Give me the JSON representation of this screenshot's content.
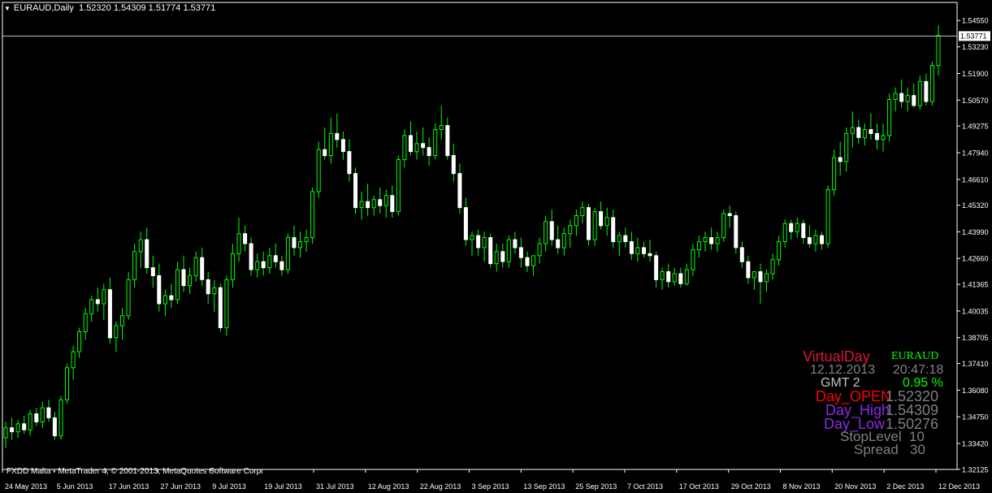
{
  "header": {
    "symbol_timeframe": "EURAUD,Daily",
    "ohlc": "1.52320 1.54309 1.51774 1.53771"
  },
  "footer": {
    "copyright": "FXDD Malta - MetaTrader 4, © 2001-2013, MetaQuotes Software Corp."
  },
  "colors": {
    "background": "#000000",
    "bull": "#00ff00",
    "bear": "#ffffff",
    "axis": "#ffffff",
    "current_price_line": "#c0c0c0"
  },
  "overlay": {
    "title": "VirtualDay",
    "symbol": "EURAUD",
    "date": "12.12.2013",
    "time": "20:47:18",
    "gmt": "GMT 2",
    "percent": "0.95 %",
    "open_label": "Day_OPEN",
    "open_value": "1.52320",
    "high_label": "Day_High",
    "high_value": "1.54309",
    "low_label": "Day_Low",
    "low_value": "1.50276",
    "stoplevel": "StopLevel  10",
    "spread": "Spread   30",
    "colors": {
      "title": "#dc143c",
      "symbol": "#00ff00",
      "date_time": "#808080",
      "gmt": "#c0c0c0",
      "percent": "#00ff00",
      "open_label": "#ff0000",
      "high_low_label": "#8a2be2",
      "values": "#808080",
      "stoplevel": "#808080"
    }
  },
  "chart_data": {
    "type": "candlestick",
    "ylim": [
      1.3212,
      1.5545
    ],
    "y_ticks": [
      "1.54550",
      "1.53230",
      "1.51900",
      "1.50570",
      "1.49275",
      "1.47940",
      "1.46610",
      "1.45320",
      "1.43990",
      "1.42660",
      "1.41365",
      "1.40035",
      "1.38705",
      "1.37410",
      "1.36080",
      "1.34750",
      "1.33420",
      "1.32125"
    ],
    "current_price": "1.53771",
    "x_labels": [
      "24 May 2013",
      "5 Jun 2013",
      "17 Jun 2013",
      "27 Jun 2013",
      "9 Jul 2013",
      "19 Jul 2013",
      "31 Jul 2013",
      "12 Aug 2013",
      "22 Aug 2013",
      "3 Sep 2013",
      "13 Sep 2013",
      "25 Sep 2013",
      "7 Oct 2013",
      "17 Oct 2013",
      "29 Oct 2013",
      "8 Nov 2013",
      "20 Nov 2013",
      "2 Dec 2013",
      "12 Dec 2013"
    ],
    "candles": [
      [
        1.337,
        1.345,
        1.332,
        1.342
      ],
      [
        1.342,
        1.347,
        1.336,
        1.34
      ],
      [
        1.34,
        1.346,
        1.337,
        1.344
      ],
      [
        1.344,
        1.348,
        1.339,
        1.341
      ],
      [
        1.341,
        1.351,
        1.338,
        1.349
      ],
      [
        1.349,
        1.352,
        1.343,
        1.345
      ],
      [
        1.345,
        1.355,
        1.342,
        1.352
      ],
      [
        1.352,
        1.356,
        1.345,
        1.347
      ],
      [
        1.347,
        1.35,
        1.336,
        1.338
      ],
      [
        1.338,
        1.358,
        1.336,
        1.356
      ],
      [
        1.356,
        1.374,
        1.354,
        1.372
      ],
      [
        1.372,
        1.383,
        1.366,
        1.38
      ],
      [
        1.38,
        1.392,
        1.377,
        1.39
      ],
      [
        1.39,
        1.402,
        1.386,
        1.399
      ],
      [
        1.399,
        1.408,
        1.395,
        1.406
      ],
      [
        1.406,
        1.412,
        1.4,
        1.404
      ],
      [
        1.404,
        1.414,
        1.396,
        1.411
      ],
      [
        1.411,
        1.417,
        1.384,
        1.387
      ],
      [
        1.387,
        1.395,
        1.38,
        1.393
      ],
      [
        1.393,
        1.402,
        1.386,
        1.398
      ],
      [
        1.398,
        1.42,
        1.396,
        1.416
      ],
      [
        1.416,
        1.434,
        1.412,
        1.43
      ],
      [
        1.43,
        1.44,
        1.422,
        1.436
      ],
      [
        1.436,
        1.442,
        1.419,
        1.422
      ],
      [
        1.422,
        1.428,
        1.412,
        1.418
      ],
      [
        1.418,
        1.424,
        1.4,
        1.404
      ],
      [
        1.404,
        1.411,
        1.398,
        1.408
      ],
      [
        1.408,
        1.414,
        1.402,
        1.406
      ],
      [
        1.406,
        1.425,
        1.404,
        1.421
      ],
      [
        1.421,
        1.428,
        1.41,
        1.413
      ],
      [
        1.413,
        1.422,
        1.409,
        1.418
      ],
      [
        1.418,
        1.43,
        1.415,
        1.427
      ],
      [
        1.427,
        1.432,
        1.413,
        1.416
      ],
      [
        1.416,
        1.42,
        1.404,
        1.409
      ],
      [
        1.409,
        1.416,
        1.4,
        1.412
      ],
      [
        1.412,
        1.414,
        1.39,
        1.392
      ],
      [
        1.392,
        1.418,
        1.388,
        1.416
      ],
      [
        1.416,
        1.434,
        1.412,
        1.429
      ],
      [
        1.429,
        1.447,
        1.425,
        1.439
      ],
      [
        1.439,
        1.443,
        1.43,
        1.434
      ],
      [
        1.434,
        1.437,
        1.418,
        1.421
      ],
      [
        1.421,
        1.429,
        1.417,
        1.425
      ],
      [
        1.425,
        1.43,
        1.418,
        1.422
      ],
      [
        1.422,
        1.432,
        1.419,
        1.428
      ],
      [
        1.428,
        1.434,
        1.422,
        1.425
      ],
      [
        1.425,
        1.428,
        1.418,
        1.421
      ],
      [
        1.421,
        1.439,
        1.419,
        1.437
      ],
      [
        1.437,
        1.443,
        1.428,
        1.432
      ],
      [
        1.432,
        1.44,
        1.427,
        1.435
      ],
      [
        1.435,
        1.441,
        1.43,
        1.437
      ],
      [
        1.437,
        1.462,
        1.434,
        1.46
      ],
      [
        1.46,
        1.485,
        1.457,
        1.481
      ],
      [
        1.481,
        1.492,
        1.476,
        1.478
      ],
      [
        1.478,
        1.497,
        1.474,
        1.489
      ],
      [
        1.489,
        1.499,
        1.482,
        1.486
      ],
      [
        1.486,
        1.49,
        1.476,
        1.48
      ],
      [
        1.48,
        1.486,
        1.465,
        1.469
      ],
      [
        1.469,
        1.472,
        1.449,
        1.452
      ],
      [
        1.452,
        1.46,
        1.446,
        1.455
      ],
      [
        1.455,
        1.464,
        1.448,
        1.452
      ],
      [
        1.452,
        1.458,
        1.448,
        1.456
      ],
      [
        1.456,
        1.462,
        1.449,
        1.453
      ],
      [
        1.453,
        1.461,
        1.447,
        1.458
      ],
      [
        1.458,
        1.463,
        1.447,
        1.45
      ],
      [
        1.45,
        1.478,
        1.448,
        1.476
      ],
      [
        1.476,
        1.491,
        1.472,
        1.488
      ],
      [
        1.488,
        1.495,
        1.478,
        1.48
      ],
      [
        1.48,
        1.49,
        1.476,
        1.484
      ],
      [
        1.484,
        1.492,
        1.478,
        1.482
      ],
      [
        1.482,
        1.487,
        1.473,
        1.478
      ],
      [
        1.478,
        1.494,
        1.476,
        1.491
      ],
      [
        1.491,
        1.503,
        1.486,
        1.493
      ],
      [
        1.493,
        1.497,
        1.476,
        1.478
      ],
      [
        1.478,
        1.484,
        1.465,
        1.469
      ],
      [
        1.469,
        1.474,
        1.449,
        1.452
      ],
      [
        1.452,
        1.457,
        1.433,
        1.436
      ],
      [
        1.436,
        1.44,
        1.428,
        1.438
      ],
      [
        1.438,
        1.441,
        1.428,
        1.432
      ],
      [
        1.432,
        1.44,
        1.425,
        1.437
      ],
      [
        1.437,
        1.439,
        1.422,
        1.424
      ],
      [
        1.424,
        1.434,
        1.42,
        1.43
      ],
      [
        1.43,
        1.434,
        1.422,
        1.425
      ],
      [
        1.425,
        1.438,
        1.422,
        1.436
      ],
      [
        1.436,
        1.44,
        1.429,
        1.432
      ],
      [
        1.432,
        1.437,
        1.422,
        1.427
      ],
      [
        1.427,
        1.43,
        1.42,
        1.423
      ],
      [
        1.423,
        1.427,
        1.418,
        1.428
      ],
      [
        1.428,
        1.437,
        1.424,
        1.434
      ],
      [
        1.434,
        1.448,
        1.43,
        1.445
      ],
      [
        1.445,
        1.451,
        1.433,
        1.436
      ],
      [
        1.436,
        1.443,
        1.429,
        1.432
      ],
      [
        1.432,
        1.442,
        1.428,
        1.439
      ],
      [
        1.439,
        1.446,
        1.432,
        1.443
      ],
      [
        1.443,
        1.451,
        1.438,
        1.448
      ],
      [
        1.448,
        1.455,
        1.444,
        1.452
      ],
      [
        1.452,
        1.454,
        1.433,
        1.436
      ],
      [
        1.436,
        1.452,
        1.433,
        1.45
      ],
      [
        1.45,
        1.455,
        1.441,
        1.443
      ],
      [
        1.443,
        1.452,
        1.438,
        1.447
      ],
      [
        1.447,
        1.451,
        1.432,
        1.435
      ],
      [
        1.435,
        1.44,
        1.428,
        1.438
      ],
      [
        1.438,
        1.442,
        1.432,
        1.435
      ],
      [
        1.435,
        1.44,
        1.426,
        1.429
      ],
      [
        1.429,
        1.437,
        1.425,
        1.432
      ],
      [
        1.432,
        1.435,
        1.427,
        1.429
      ],
      [
        1.429,
        1.436,
        1.425,
        1.428
      ],
      [
        1.428,
        1.43,
        1.412,
        1.416
      ],
      [
        1.416,
        1.422,
        1.411,
        1.42
      ],
      [
        1.42,
        1.424,
        1.412,
        1.415
      ],
      [
        1.415,
        1.422,
        1.413,
        1.419
      ],
      [
        1.419,
        1.422,
        1.412,
        1.414
      ],
      [
        1.414,
        1.424,
        1.413,
        1.421
      ],
      [
        1.421,
        1.434,
        1.418,
        1.431
      ],
      [
        1.431,
        1.438,
        1.427,
        1.435
      ],
      [
        1.435,
        1.44,
        1.43,
        1.437
      ],
      [
        1.437,
        1.442,
        1.431,
        1.434
      ],
      [
        1.434,
        1.44,
        1.43,
        1.437
      ],
      [
        1.437,
        1.451,
        1.435,
        1.449
      ],
      [
        1.449,
        1.453,
        1.442,
        1.448
      ],
      [
        1.448,
        1.45,
        1.429,
        1.432
      ],
      [
        1.432,
        1.435,
        1.422,
        1.425
      ],
      [
        1.425,
        1.428,
        1.414,
        1.417
      ],
      [
        1.417,
        1.42,
        1.411,
        1.42
      ],
      [
        1.42,
        1.424,
        1.404,
        1.415
      ],
      [
        1.415,
        1.421,
        1.41,
        1.419
      ],
      [
        1.419,
        1.429,
        1.416,
        1.426
      ],
      [
        1.426,
        1.438,
        1.423,
        1.435
      ],
      [
        1.435,
        1.446,
        1.432,
        1.444
      ],
      [
        1.444,
        1.446,
        1.436,
        1.44
      ],
      [
        1.44,
        1.447,
        1.437,
        1.444
      ],
      [
        1.444,
        1.446,
        1.434,
        1.437
      ],
      [
        1.437,
        1.443,
        1.432,
        1.434
      ],
      [
        1.434,
        1.441,
        1.43,
        1.438
      ],
      [
        1.438,
        1.44,
        1.431,
        1.434
      ],
      [
        1.434,
        1.463,
        1.432,
        1.461
      ],
      [
        1.461,
        1.481,
        1.458,
        1.477
      ],
      [
        1.477,
        1.485,
        1.468,
        1.475
      ],
      [
        1.475,
        1.492,
        1.47,
        1.489
      ],
      [
        1.489,
        1.5,
        1.482,
        1.492
      ],
      [
        1.492,
        1.496,
        1.484,
        1.487
      ],
      [
        1.487,
        1.494,
        1.483,
        1.491
      ],
      [
        1.491,
        1.499,
        1.486,
        1.489
      ],
      [
        1.489,
        1.494,
        1.481,
        1.486
      ],
      [
        1.486,
        1.494,
        1.48,
        1.488
      ],
      [
        1.488,
        1.509,
        1.485,
        1.506
      ],
      [
        1.506,
        1.512,
        1.5,
        1.509
      ],
      [
        1.509,
        1.516,
        1.502,
        1.505
      ],
      [
        1.505,
        1.512,
        1.5,
        1.508
      ],
      [
        1.508,
        1.514,
        1.502,
        1.503
      ],
      [
        1.503,
        1.518,
        1.501,
        1.515
      ],
      [
        1.515,
        1.519,
        1.503,
        1.505
      ],
      [
        1.505,
        1.525,
        1.503,
        1.523
      ],
      [
        1.523,
        1.543,
        1.518,
        1.538
      ]
    ]
  }
}
